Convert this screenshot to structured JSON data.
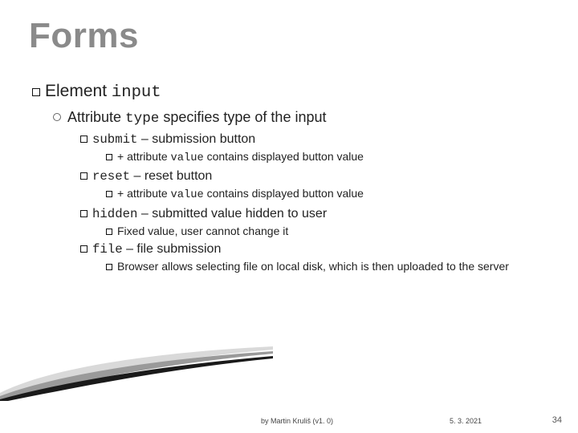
{
  "title": "Forms",
  "l1": {
    "prefix": "Element ",
    "code": "input"
  },
  "l2": {
    "prefix": "Attribute ",
    "code": "type",
    "suffix": " specifies type of the input"
  },
  "items": [
    {
      "code": "submit",
      "text": " – submission button",
      "sub": [
        {
          "prefix": "+ attribute ",
          "code": "value",
          "suffix": " contains displayed button value"
        }
      ]
    },
    {
      "code": "reset",
      "text": " – reset button",
      "sub": [
        {
          "prefix": "+ attribute ",
          "code": "value",
          "suffix": " contains displayed button value"
        }
      ]
    },
    {
      "code": "hidden",
      "text": " – submitted value hidden to user",
      "sub": [
        {
          "prefix": "Fixed value, user cannot change it",
          "code": "",
          "suffix": ""
        }
      ]
    },
    {
      "code": "file",
      "text": " – file submission",
      "sub": [
        {
          "prefix": "Browser allows selecting file on local disk, which is then uploaded to the server",
          "code": "",
          "suffix": ""
        }
      ]
    }
  ],
  "footer": {
    "author": "by Martin Kruliš (v1. 0)",
    "date": "5. 3. 2021",
    "page": "34"
  }
}
